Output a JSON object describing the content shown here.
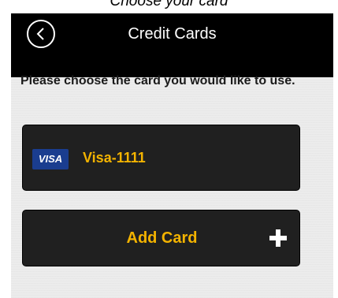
{
  "caption": "Choose your card",
  "header": {
    "title": "Credit Cards",
    "back_icon": "chevron-left-icon"
  },
  "main": {
    "instruction": "Please choose the card you would like to use.",
    "cards": [
      {
        "brand": "VISA",
        "name": "Visa-1111"
      }
    ],
    "add_card_label": "Add Card",
    "add_icon": "plus-icon"
  },
  "colors": {
    "accent": "#f3b300",
    "header_bg": "#000000",
    "row_bg": "#202020",
    "visa_blue": "#1a3d8f"
  }
}
